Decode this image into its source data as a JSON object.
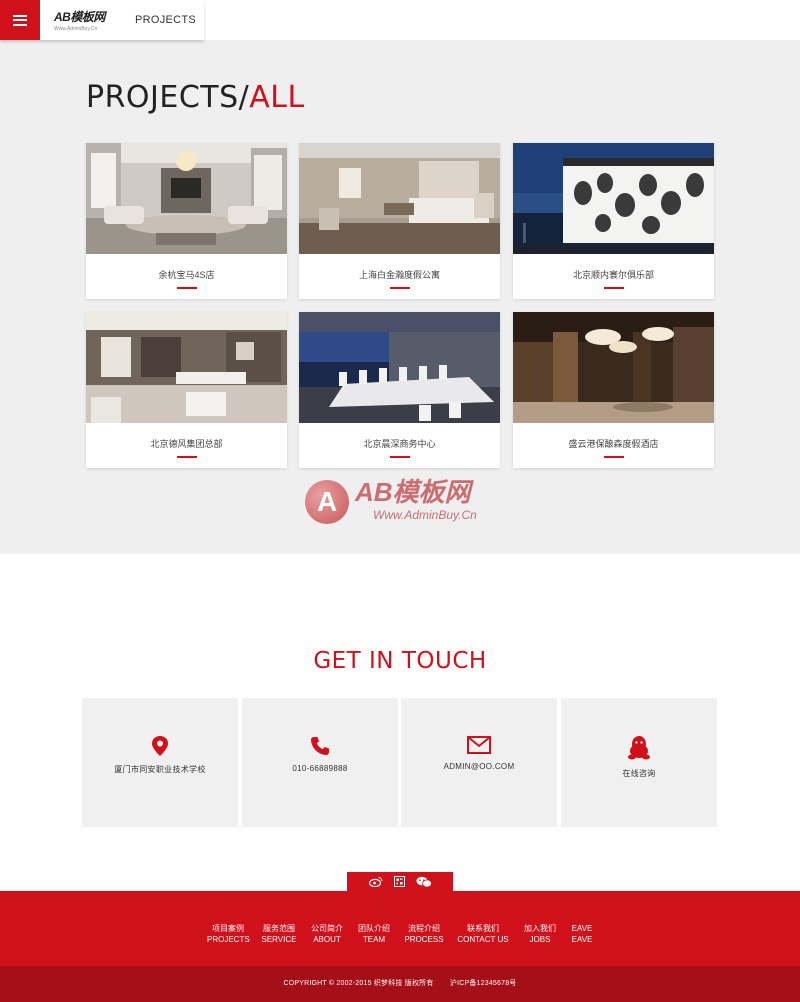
{
  "header": {
    "logo_text": "AB模板网",
    "logo_sub": "Www.AdminBuy.Cn",
    "current_section": "PROJECTS"
  },
  "projects": {
    "title_main": "PROJECTS/",
    "title_accent": "ALL",
    "items": [
      {
        "caption": "余杭宝马4S店"
      },
      {
        "caption": "上海白金瀚度假公寓"
      },
      {
        "caption": "北京顺内寰尔俱乐部"
      },
      {
        "caption": "北京德风集团总部"
      },
      {
        "caption": "北京晨深商务中心"
      },
      {
        "caption": "盛云港保酿森度假酒店"
      }
    ]
  },
  "watermark": {
    "text": "AB模板网",
    "url": "Www.AdminBuy.Cn"
  },
  "contact": {
    "title": "GET IN TOUCH",
    "items": [
      {
        "icon": "location-pin-icon",
        "text": "厦门市同安职业技术学校"
      },
      {
        "icon": "phone-icon",
        "text": "010-66889888"
      },
      {
        "icon": "mail-icon",
        "text": "ADMIN@OO.COM"
      },
      {
        "icon": "qq-penguin-icon",
        "text": "在线咨询"
      }
    ]
  },
  "footer": {
    "social": [
      "weibo-icon",
      "qrcode-icon",
      "wechat-icon"
    ],
    "nav": [
      {
        "cn": "项目案例",
        "en": "PROJECTS"
      },
      {
        "cn": "服务范围",
        "en": "SERVICE"
      },
      {
        "cn": "公司简介",
        "en": "ABOUT"
      },
      {
        "cn": "团队介绍",
        "en": "TEAM"
      },
      {
        "cn": "流程介绍",
        "en": "PROCESS"
      },
      {
        "cn": "联系我们",
        "en": "CONTACT US"
      },
      {
        "cn": "加入我们",
        "en": "JOBS"
      },
      {
        "cn": "EAVE",
        "en": "EAVE"
      }
    ],
    "copyright": "COPYRIGHT © 2002-2015 织梦科技 版权所有",
    "icp": "沪ICP备12345678号"
  },
  "colors": {
    "accent": "#d0111b",
    "footer_dark": "#a50f17",
    "section_bg": "#efefef"
  }
}
